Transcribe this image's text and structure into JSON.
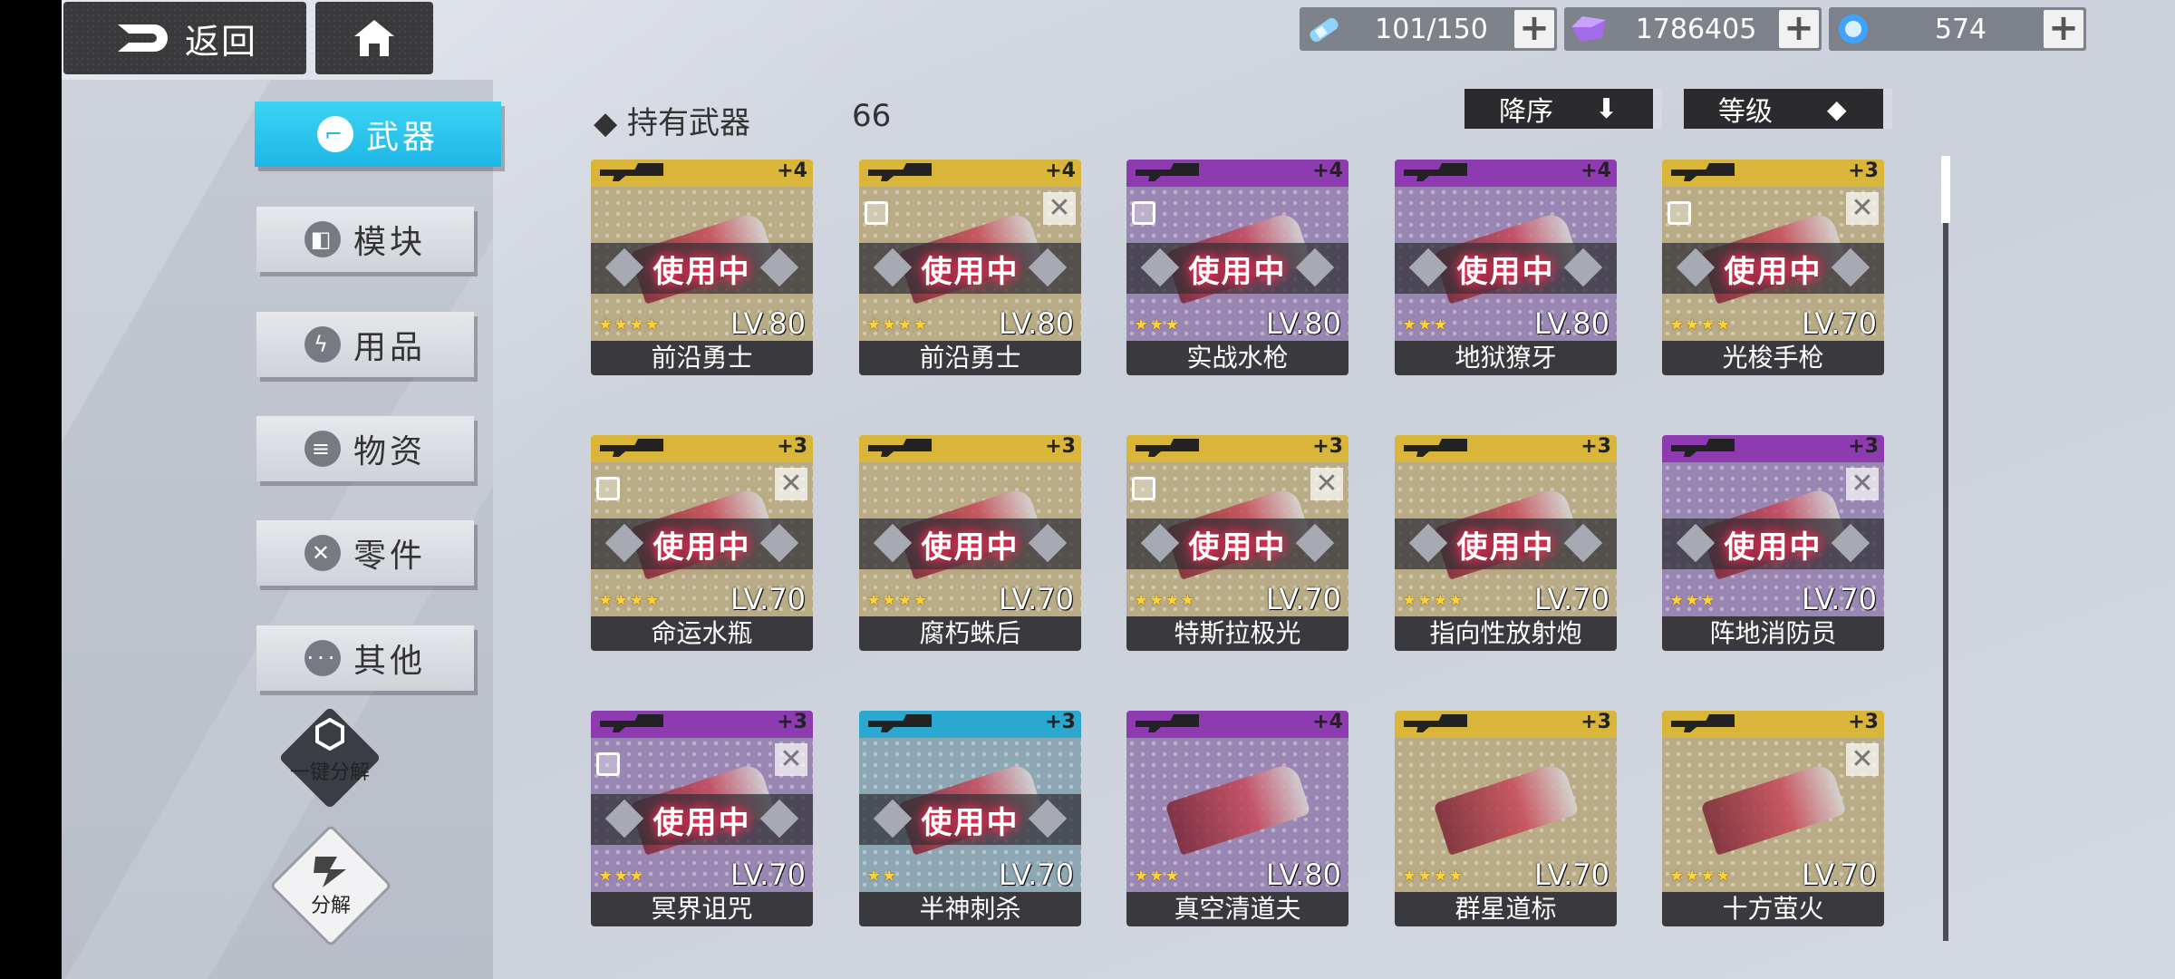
{
  "topbar": {
    "back_label": "返回",
    "resources": [
      {
        "icon": "energy-vial-icon",
        "value": "101/150"
      },
      {
        "icon": "purple-crystal-icon",
        "value": "1786405"
      },
      {
        "icon": "blue-orb-icon",
        "value": "574"
      }
    ],
    "plus_label": "+"
  },
  "sidebar": {
    "items": [
      {
        "label": "武器",
        "icon": "weapon-icon",
        "active": true
      },
      {
        "label": "模块",
        "icon": "module-icon"
      },
      {
        "label": "用品",
        "icon": "lightning-icon"
      },
      {
        "label": "物资",
        "icon": "supplies-icon"
      },
      {
        "label": "零件",
        "icon": "parts-icon"
      },
      {
        "label": "其他",
        "icon": "more-icon"
      }
    ],
    "quick_dismantle": "一键分解",
    "dismantle": "分解"
  },
  "header": {
    "owned_label": "◆ 持有武器",
    "owned_count": "66",
    "sort_order": "降序",
    "sort_field": "等级"
  },
  "colors": {
    "gold": "#d9b53a",
    "purple": "#8e3ab0",
    "cyan": "#2aa8cf",
    "accent": "#1fb7e6"
  },
  "weapons": [
    {
      "name": "前沿勇士",
      "lv": "LV.80",
      "plus": "+4",
      "stars": "★★★★",
      "rarity": "gold",
      "in_use": "使用中",
      "locked": false,
      "wrench": false
    },
    {
      "name": "前沿勇士",
      "lv": "LV.80",
      "plus": "+4",
      "stars": "★★★★",
      "rarity": "gold",
      "in_use": "使用中",
      "locked": true,
      "wrench": true
    },
    {
      "name": "实战水枪",
      "lv": "LV.80",
      "plus": "+4",
      "stars": "★★★",
      "rarity": "purple",
      "in_use": "使用中",
      "locked": true,
      "wrench": false
    },
    {
      "name": "地狱獠牙",
      "lv": "LV.80",
      "plus": "+4",
      "stars": "★★★",
      "rarity": "purple",
      "in_use": "使用中",
      "locked": false,
      "wrench": false
    },
    {
      "name": "光梭手枪",
      "lv": "LV.70",
      "plus": "+3",
      "stars": "★★★★",
      "rarity": "gold",
      "in_use": "使用中",
      "locked": true,
      "wrench": true
    },
    {
      "name": "命运水瓶",
      "lv": "LV.70",
      "plus": "+3",
      "stars": "★★★★",
      "rarity": "gold",
      "in_use": "使用中",
      "locked": true,
      "wrench": true
    },
    {
      "name": "腐朽蛛后",
      "lv": "LV.70",
      "plus": "+3",
      "stars": "★★★★",
      "rarity": "gold",
      "in_use": "使用中",
      "locked": false,
      "wrench": false
    },
    {
      "name": "特斯拉极光",
      "lv": "LV.70",
      "plus": "+3",
      "stars": "★★★★",
      "rarity": "gold",
      "in_use": "使用中",
      "locked": true,
      "wrench": true
    },
    {
      "name": "指向性放射炮",
      "lv": "LV.70",
      "plus": "+3",
      "stars": "★★★★",
      "rarity": "gold",
      "in_use": "使用中",
      "locked": false,
      "wrench": false
    },
    {
      "name": "阵地消防员",
      "lv": "LV.70",
      "plus": "+3",
      "stars": "★★★",
      "rarity": "purple",
      "in_use": "使用中",
      "locked": false,
      "wrench": true
    },
    {
      "name": "冥界诅咒",
      "lv": "LV.70",
      "plus": "+3",
      "stars": "★★★",
      "rarity": "purple",
      "in_use": "使用中",
      "locked": true,
      "wrench": true
    },
    {
      "name": "半神刺杀",
      "lv": "LV.70",
      "plus": "+3",
      "stars": "★★",
      "rarity": "cyan",
      "in_use": "使用中",
      "locked": false,
      "wrench": false
    },
    {
      "name": "真空清道夫",
      "lv": "LV.80",
      "plus": "+4",
      "stars": "★★★",
      "rarity": "purple",
      "in_use": "",
      "locked": false,
      "wrench": false
    },
    {
      "name": "群星道标",
      "lv": "LV.70",
      "plus": "+3",
      "stars": "★★★★",
      "rarity": "gold",
      "in_use": "",
      "locked": false,
      "wrench": false
    },
    {
      "name": "十方萤火",
      "lv": "LV.70",
      "plus": "+3",
      "stars": "★★★★",
      "rarity": "gold",
      "in_use": "",
      "locked": false,
      "wrench": true
    }
  ]
}
